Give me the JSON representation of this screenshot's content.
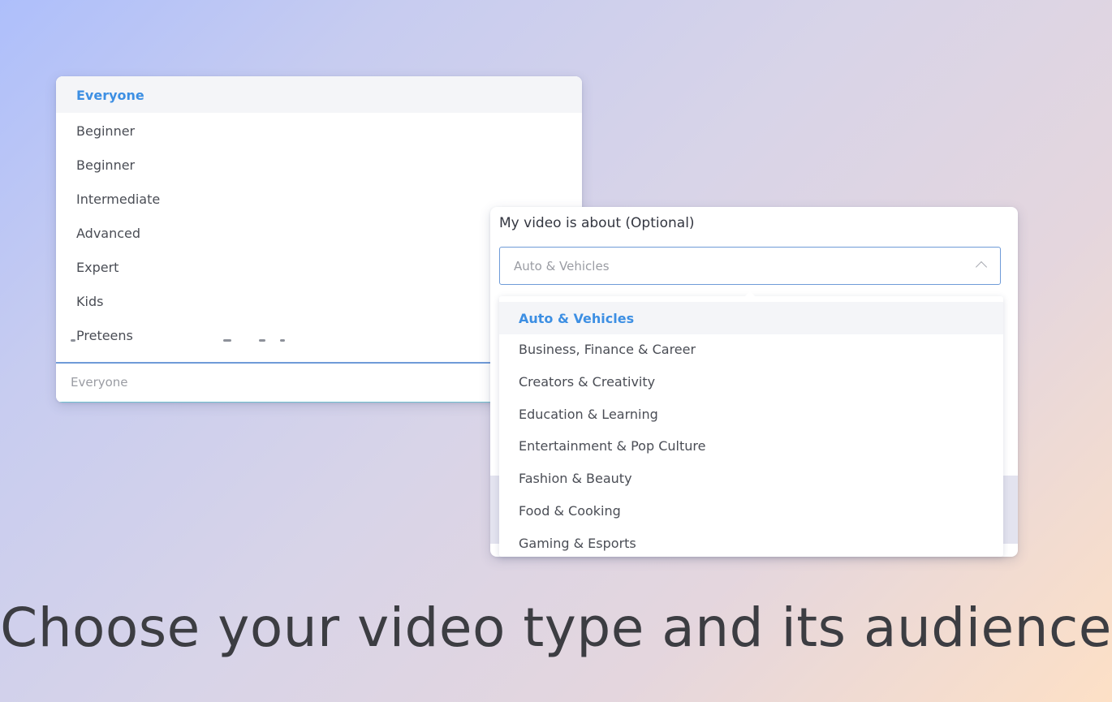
{
  "audience": {
    "options": [
      "Everyone",
      "Beginner",
      "Beginner",
      "Intermediate",
      "Advanced",
      "Expert",
      "Kids",
      "Preteens"
    ],
    "selected": "Everyone",
    "input_value": "Everyone"
  },
  "topic": {
    "label": "My video is about (Optional)",
    "selected_value": "Auto & Vehicles",
    "options": [
      "Auto & Vehicles",
      "Business, Finance & Career",
      "Creators & Creativity",
      "Education & Learning",
      "Entertainment & Pop Culture",
      "Fashion & Beauty",
      "Food & Cooking",
      "Gaming & Esports"
    ]
  },
  "headline": "Choose your video type and its audience",
  "colors": {
    "accent": "#3d8fe3",
    "text": "#4a4d55",
    "headline": "#3c3d42"
  },
  "icons": {
    "chevron": "chevron-up-icon"
  }
}
